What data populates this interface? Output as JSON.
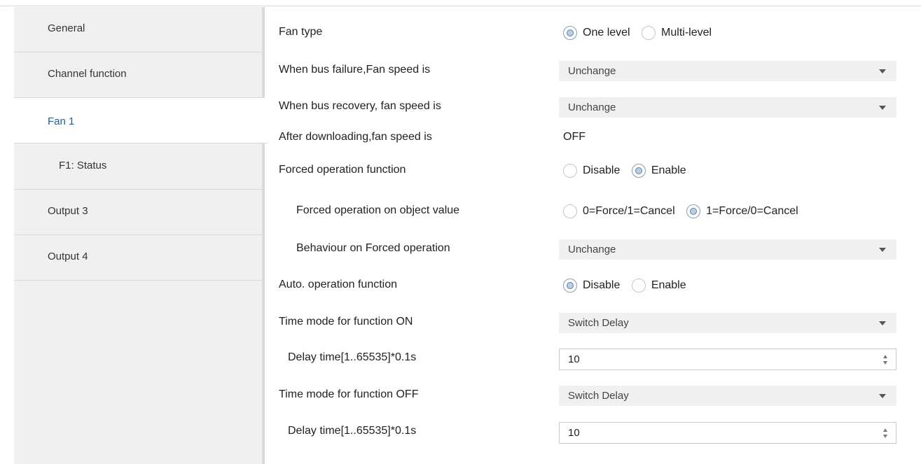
{
  "sidebar": {
    "items": [
      {
        "label": "General"
      },
      {
        "label": "Channel function"
      },
      {
        "label": "Fan 1"
      },
      {
        "label": "F1: Status"
      },
      {
        "label": "Output 3"
      },
      {
        "label": "Output 4"
      }
    ],
    "active_index": 2
  },
  "settings": {
    "fan_type": {
      "label": "Fan type",
      "options": [
        "One level",
        "Multi-level"
      ],
      "selected": "One level"
    },
    "bus_failure": {
      "label": "When bus failure,Fan speed is",
      "value": "Unchange"
    },
    "bus_recovery": {
      "label": "When bus recovery, fan speed is",
      "value": "Unchange"
    },
    "after_download": {
      "label": "After downloading,fan speed is",
      "value": "OFF"
    },
    "forced_function": {
      "label": "Forced operation function",
      "options": [
        "Disable",
        "Enable"
      ],
      "selected": "Enable"
    },
    "forced_object": {
      "label": "Forced operation on object value",
      "options": [
        "0=Force/1=Cancel",
        "1=Force/0=Cancel"
      ],
      "selected": "1=Force/0=Cancel"
    },
    "forced_behaviour": {
      "label": "Behaviour on Forced operation",
      "value": "Unchange"
    },
    "auto_function": {
      "label": "Auto. operation function",
      "options": [
        "Disable",
        "Enable"
      ],
      "selected": "Disable"
    },
    "time_mode_on": {
      "label": "Time mode for function ON",
      "value": "Switch Delay"
    },
    "delay_on": {
      "label": "Delay time[1..65535]*0.1s",
      "value": "10"
    },
    "time_mode_off": {
      "label": "Time mode for function OFF",
      "value": "Switch Delay"
    },
    "delay_off": {
      "label": "Delay time[1..65535]*0.1s",
      "value": "10"
    }
  },
  "colors": {
    "active_nav_text": "#1a5fa0",
    "sidebar_bg": "#f0f0f0",
    "select_bg": "#f0f0f0"
  }
}
